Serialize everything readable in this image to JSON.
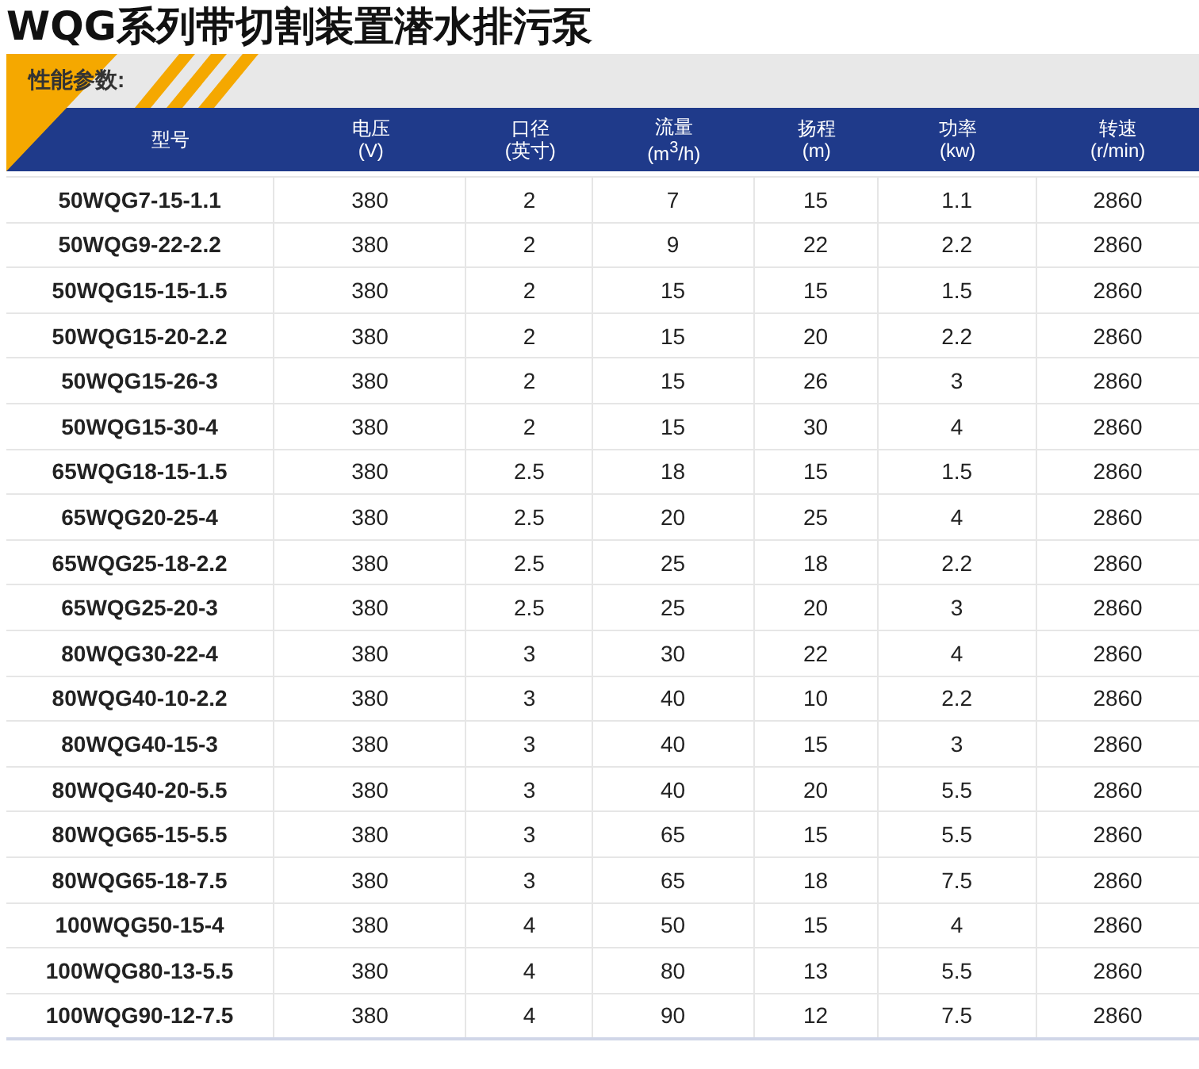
{
  "title": "WQG系列带切割装置潜水排污泵",
  "section_label": "性能参数:",
  "table": {
    "columns": [
      {
        "name": "型号"
      },
      {
        "name": "电压",
        "unit": "(V)"
      },
      {
        "name": "口径",
        "unit": "(英寸)"
      },
      {
        "name": "流量",
        "unit": "(m$^{3}$/h)"
      },
      {
        "name": "扬程",
        "unit": "(m)"
      },
      {
        "name": "功率",
        "unit": "(kw)"
      },
      {
        "name": "转速",
        "unit": "(r/min)"
      }
    ],
    "rows": [
      [
        "50WQG7-15-1.1",
        "380",
        "2",
        "7",
        "15",
        "1.1",
        "2860"
      ],
      [
        "50WQG9-22-2.2",
        "380",
        "2",
        "9",
        "22",
        "2.2",
        "2860"
      ],
      [
        "50WQG15-15-1.5",
        "380",
        "2",
        "15",
        "15",
        "1.5",
        "2860"
      ],
      [
        "50WQG15-20-2.2",
        "380",
        "2",
        "15",
        "20",
        "2.2",
        "2860"
      ],
      [
        "50WQG15-26-3",
        "380",
        "2",
        "15",
        "26",
        "3",
        "2860"
      ],
      [
        "50WQG15-30-4",
        "380",
        "2",
        "15",
        "30",
        "4",
        "2860"
      ],
      [
        "65WQG18-15-1.5",
        "380",
        "2.5",
        "18",
        "15",
        "1.5",
        "2860"
      ],
      [
        "65WQG20-25-4",
        "380",
        "2.5",
        "20",
        "25",
        "4",
        "2860"
      ],
      [
        "65WQG25-18-2.2",
        "380",
        "2.5",
        "25",
        "18",
        "2.2",
        "2860"
      ],
      [
        "65WQG25-20-3",
        "380",
        "2.5",
        "25",
        "20",
        "3",
        "2860"
      ],
      [
        "80WQG30-22-4",
        "380",
        "3",
        "30",
        "22",
        "4",
        "2860"
      ],
      [
        "80WQG40-10-2.2",
        "380",
        "3",
        "40",
        "10",
        "2.2",
        "2860"
      ],
      [
        "80WQG40-15-3",
        "380",
        "3",
        "40",
        "15",
        "3",
        "2860"
      ],
      [
        "80WQG40-20-5.5",
        "380",
        "3",
        "40",
        "20",
        "5.5",
        "2860"
      ],
      [
        "80WQG65-15-5.5",
        "380",
        "3",
        "65",
        "15",
        "5.5",
        "2860"
      ],
      [
        "80WQG65-18-7.5",
        "380",
        "3",
        "65",
        "18",
        "7.5",
        "2860"
      ],
      [
        "100WQG50-15-4",
        "380",
        "4",
        "50",
        "15",
        "4",
        "2860"
      ],
      [
        "100WQG80-13-5.5",
        "380",
        "4",
        "80",
        "13",
        "5.5",
        "2860"
      ],
      [
        "100WQG90-12-7.5",
        "380",
        "4",
        "90",
        "12",
        "7.5",
        "2860"
      ]
    ]
  }
}
